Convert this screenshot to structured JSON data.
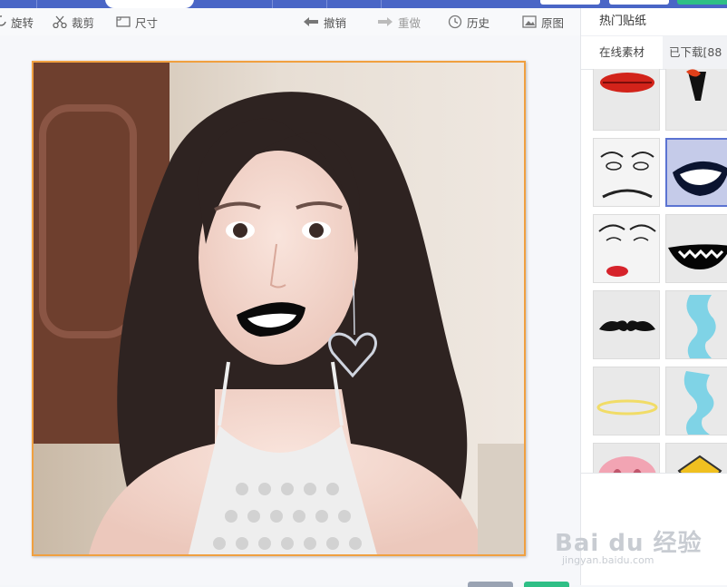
{
  "toolbar": {
    "rotate": "旋转",
    "crop": "裁剪",
    "size": "尺寸",
    "undo": "撤销",
    "redo": "重做",
    "history": "历史",
    "original": "原图"
  },
  "panel": {
    "title": "热门贴纸",
    "tabs": [
      {
        "label": "在线素材"
      },
      {
        "label": "已下载[88"
      }
    ],
    "stickers": [
      {
        "icon": "red-lips-icon"
      },
      {
        "icon": "vampire-mouth-icon"
      },
      {
        "icon": "rage-face-icon"
      },
      {
        "icon": "grin-mouth-icon"
      },
      {
        "icon": "meme-face-red-lips-icon"
      },
      {
        "icon": "black-grin-icon"
      },
      {
        "icon": "mustache-icon"
      },
      {
        "icon": "blue-wavy-shape-icon"
      },
      {
        "icon": "yellow-halo-icon"
      },
      {
        "icon": "blue-wavy-shape-icon"
      },
      {
        "icon": "pig-nose-icon"
      },
      {
        "icon": "yellow-gem-icon"
      }
    ]
  },
  "watermark": {
    "brand": "Bai du 经验",
    "url": "jingyan.baidu.com"
  },
  "colors": {
    "nav": "#4a66c6",
    "accent_border": "#f0a040",
    "selected_sticker": "#5b73d2"
  }
}
